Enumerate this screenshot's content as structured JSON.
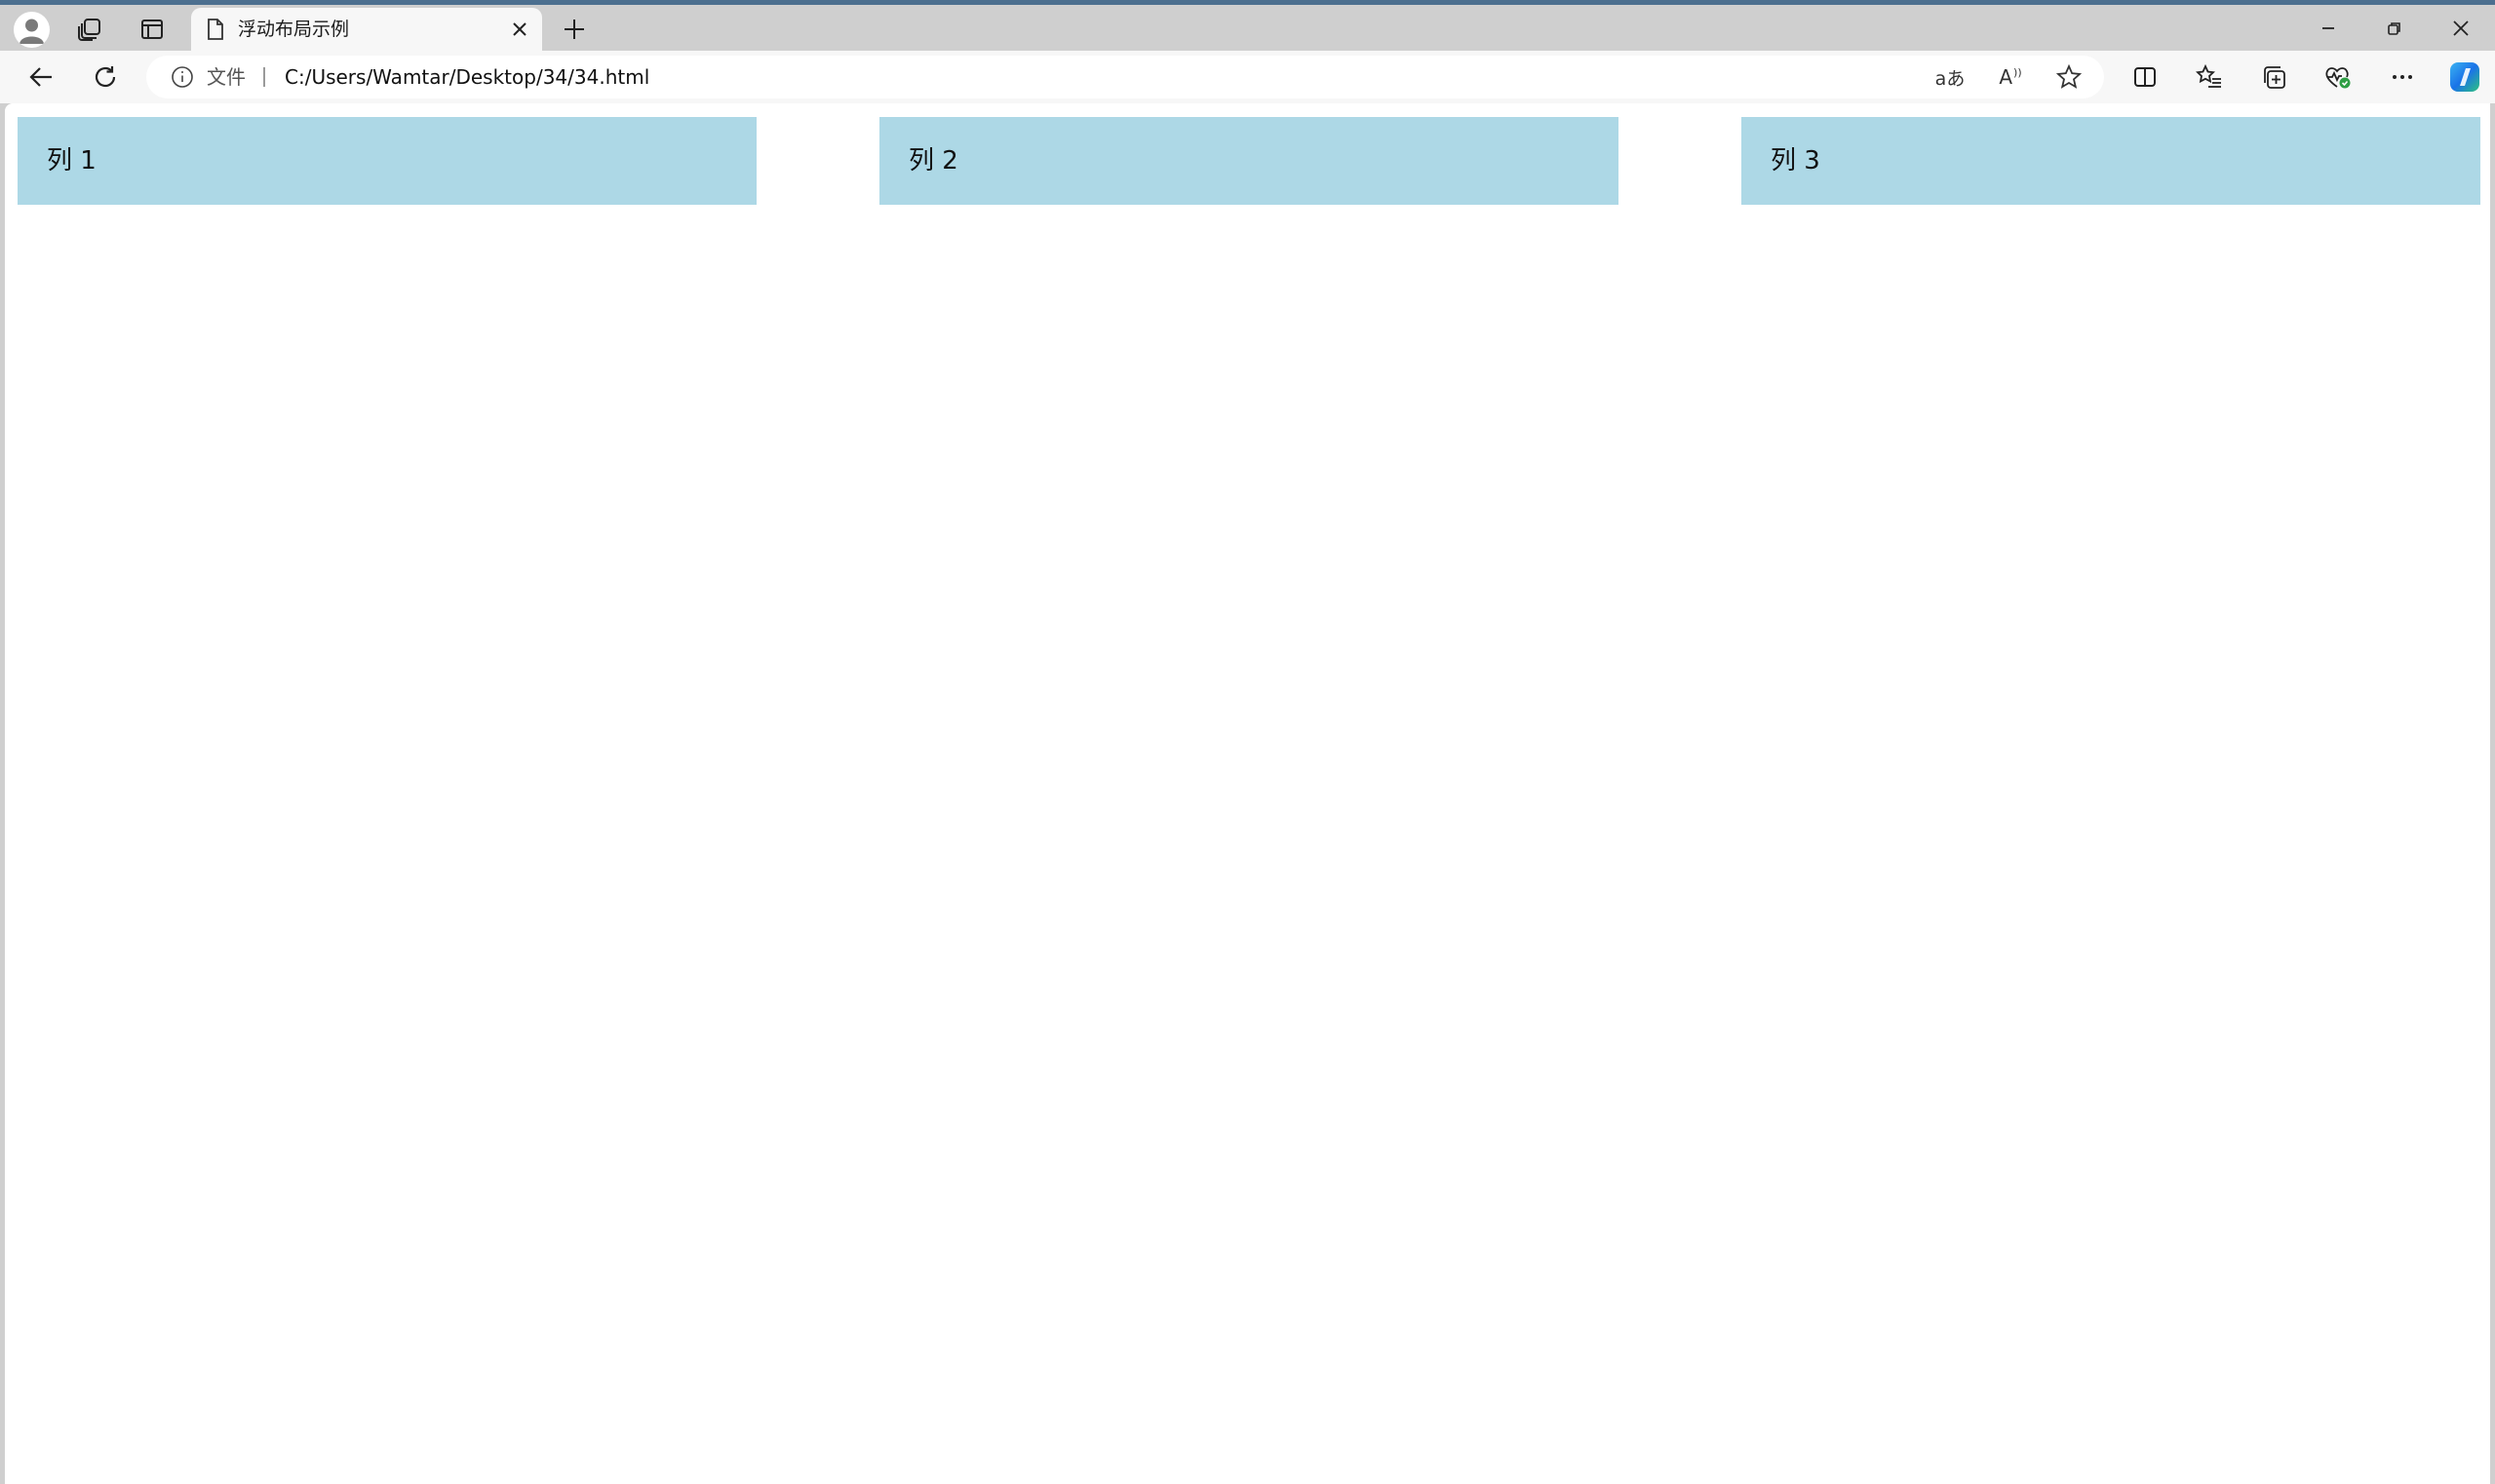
{
  "tab": {
    "title": "浮动布局示例"
  },
  "address_bar": {
    "label": "文件",
    "url": "C:/Users/Wamtar/Desktop/34/34.html"
  },
  "toolbar": {
    "read_aloud_label": "A",
    "translate_label": "aあ"
  },
  "page": {
    "columns": [
      {
        "label": "列 1"
      },
      {
        "label": "列 2"
      },
      {
        "label": "列 3"
      }
    ],
    "column_bg": "#add8e6"
  },
  "colors": {
    "tabstrip": "#cfcfcf",
    "toolbar": "#f7f7f7",
    "accent_bar": "#4c6f8f",
    "copilot_blue": "#1a73e8"
  }
}
